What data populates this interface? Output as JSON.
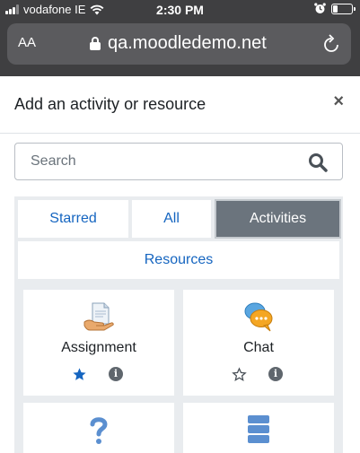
{
  "status_bar": {
    "carrier": "vodafone IE",
    "time": "2:30 PM"
  },
  "browser": {
    "text_size_label": "AA",
    "url": "qa.moodledemo.net"
  },
  "modal": {
    "title": "Add an activity or resource",
    "close_label": "×"
  },
  "search": {
    "placeholder": "Search"
  },
  "tabs": [
    {
      "label": "Starred",
      "active": false
    },
    {
      "label": "All",
      "active": false
    },
    {
      "label": "Activities",
      "active": true
    },
    {
      "label": "Resources",
      "active": false
    }
  ],
  "items": [
    {
      "name": "Assignment",
      "icon": "assignment-icon",
      "starred": true,
      "info": "i"
    },
    {
      "name": "Chat",
      "icon": "chat-icon",
      "starred": false,
      "info": "i"
    },
    {
      "name": "",
      "icon": "question-icon"
    },
    {
      "name": "",
      "icon": "database-icon"
    }
  ],
  "colors": {
    "link_blue": "#1565c0",
    "active_tab": "#6b747d",
    "panel_bg": "#e9ecef"
  }
}
